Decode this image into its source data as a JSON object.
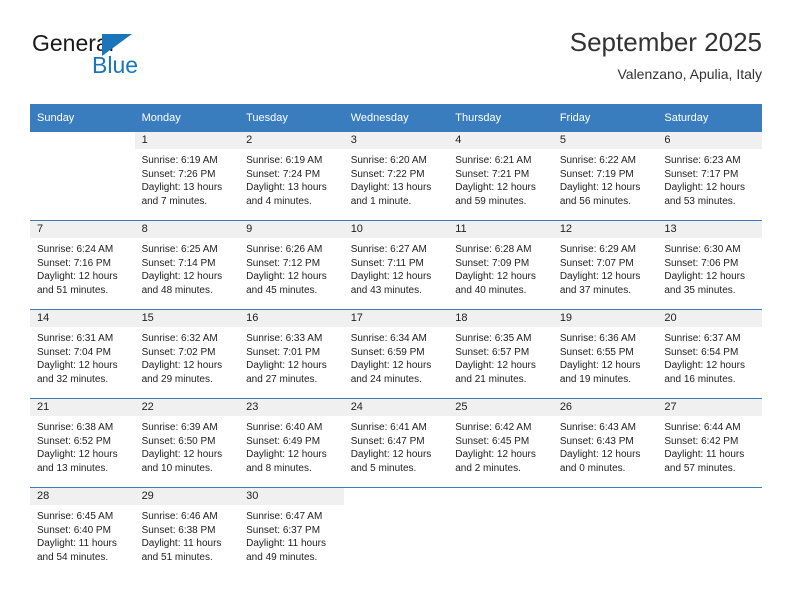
{
  "brand": {
    "line1": "General",
    "line2": "Blue",
    "triangle_color": "#1b75bb"
  },
  "header": {
    "title": "September 2025",
    "subtitle": "Valenzano, Apulia, Italy"
  },
  "theme": {
    "header_bg": "#3a7dbf",
    "header_text": "#ffffff",
    "daynum_bg": "#f0f0f0",
    "cell_bg": "#ffffff",
    "text": "#222222"
  },
  "weekdays": [
    "Sunday",
    "Monday",
    "Tuesday",
    "Wednesday",
    "Thursday",
    "Friday",
    "Saturday"
  ],
  "weeks": [
    [
      {
        "day": "",
        "blank": true
      },
      {
        "day": "1",
        "sunrise": "Sunrise: 6:19 AM",
        "sunset": "Sunset: 7:26 PM",
        "daylight": "Daylight: 13 hours and 7 minutes."
      },
      {
        "day": "2",
        "sunrise": "Sunrise: 6:19 AM",
        "sunset": "Sunset: 7:24 PM",
        "daylight": "Daylight: 13 hours and 4 minutes."
      },
      {
        "day": "3",
        "sunrise": "Sunrise: 6:20 AM",
        "sunset": "Sunset: 7:22 PM",
        "daylight": "Daylight: 13 hours and 1 minute."
      },
      {
        "day": "4",
        "sunrise": "Sunrise: 6:21 AM",
        "sunset": "Sunset: 7:21 PM",
        "daylight": "Daylight: 12 hours and 59 minutes."
      },
      {
        "day": "5",
        "sunrise": "Sunrise: 6:22 AM",
        "sunset": "Sunset: 7:19 PM",
        "daylight": "Daylight: 12 hours and 56 minutes."
      },
      {
        "day": "6",
        "sunrise": "Sunrise: 6:23 AM",
        "sunset": "Sunset: 7:17 PM",
        "daylight": "Daylight: 12 hours and 53 minutes."
      }
    ],
    [
      {
        "day": "7",
        "sunrise": "Sunrise: 6:24 AM",
        "sunset": "Sunset: 7:16 PM",
        "daylight": "Daylight: 12 hours and 51 minutes."
      },
      {
        "day": "8",
        "sunrise": "Sunrise: 6:25 AM",
        "sunset": "Sunset: 7:14 PM",
        "daylight": "Daylight: 12 hours and 48 minutes."
      },
      {
        "day": "9",
        "sunrise": "Sunrise: 6:26 AM",
        "sunset": "Sunset: 7:12 PM",
        "daylight": "Daylight: 12 hours and 45 minutes."
      },
      {
        "day": "10",
        "sunrise": "Sunrise: 6:27 AM",
        "sunset": "Sunset: 7:11 PM",
        "daylight": "Daylight: 12 hours and 43 minutes."
      },
      {
        "day": "11",
        "sunrise": "Sunrise: 6:28 AM",
        "sunset": "Sunset: 7:09 PM",
        "daylight": "Daylight: 12 hours and 40 minutes."
      },
      {
        "day": "12",
        "sunrise": "Sunrise: 6:29 AM",
        "sunset": "Sunset: 7:07 PM",
        "daylight": "Daylight: 12 hours and 37 minutes."
      },
      {
        "day": "13",
        "sunrise": "Sunrise: 6:30 AM",
        "sunset": "Sunset: 7:06 PM",
        "daylight": "Daylight: 12 hours and 35 minutes."
      }
    ],
    [
      {
        "day": "14",
        "sunrise": "Sunrise: 6:31 AM",
        "sunset": "Sunset: 7:04 PM",
        "daylight": "Daylight: 12 hours and 32 minutes."
      },
      {
        "day": "15",
        "sunrise": "Sunrise: 6:32 AM",
        "sunset": "Sunset: 7:02 PM",
        "daylight": "Daylight: 12 hours and 29 minutes."
      },
      {
        "day": "16",
        "sunrise": "Sunrise: 6:33 AM",
        "sunset": "Sunset: 7:01 PM",
        "daylight": "Daylight: 12 hours and 27 minutes."
      },
      {
        "day": "17",
        "sunrise": "Sunrise: 6:34 AM",
        "sunset": "Sunset: 6:59 PM",
        "daylight": "Daylight: 12 hours and 24 minutes."
      },
      {
        "day": "18",
        "sunrise": "Sunrise: 6:35 AM",
        "sunset": "Sunset: 6:57 PM",
        "daylight": "Daylight: 12 hours and 21 minutes."
      },
      {
        "day": "19",
        "sunrise": "Sunrise: 6:36 AM",
        "sunset": "Sunset: 6:55 PM",
        "daylight": "Daylight: 12 hours and 19 minutes."
      },
      {
        "day": "20",
        "sunrise": "Sunrise: 6:37 AM",
        "sunset": "Sunset: 6:54 PM",
        "daylight": "Daylight: 12 hours and 16 minutes."
      }
    ],
    [
      {
        "day": "21",
        "sunrise": "Sunrise: 6:38 AM",
        "sunset": "Sunset: 6:52 PM",
        "daylight": "Daylight: 12 hours and 13 minutes."
      },
      {
        "day": "22",
        "sunrise": "Sunrise: 6:39 AM",
        "sunset": "Sunset: 6:50 PM",
        "daylight": "Daylight: 12 hours and 10 minutes."
      },
      {
        "day": "23",
        "sunrise": "Sunrise: 6:40 AM",
        "sunset": "Sunset: 6:49 PM",
        "daylight": "Daylight: 12 hours and 8 minutes."
      },
      {
        "day": "24",
        "sunrise": "Sunrise: 6:41 AM",
        "sunset": "Sunset: 6:47 PM",
        "daylight": "Daylight: 12 hours and 5 minutes."
      },
      {
        "day": "25",
        "sunrise": "Sunrise: 6:42 AM",
        "sunset": "Sunset: 6:45 PM",
        "daylight": "Daylight: 12 hours and 2 minutes."
      },
      {
        "day": "26",
        "sunrise": "Sunrise: 6:43 AM",
        "sunset": "Sunset: 6:43 PM",
        "daylight": "Daylight: 12 hours and 0 minutes."
      },
      {
        "day": "27",
        "sunrise": "Sunrise: 6:44 AM",
        "sunset": "Sunset: 6:42 PM",
        "daylight": "Daylight: 11 hours and 57 minutes."
      }
    ],
    [
      {
        "day": "28",
        "sunrise": "Sunrise: 6:45 AM",
        "sunset": "Sunset: 6:40 PM",
        "daylight": "Daylight: 11 hours and 54 minutes."
      },
      {
        "day": "29",
        "sunrise": "Sunrise: 6:46 AM",
        "sunset": "Sunset: 6:38 PM",
        "daylight": "Daylight: 11 hours and 51 minutes."
      },
      {
        "day": "30",
        "sunrise": "Sunrise: 6:47 AM",
        "sunset": "Sunset: 6:37 PM",
        "daylight": "Daylight: 11 hours and 49 minutes."
      },
      {
        "day": "",
        "blank": true
      },
      {
        "day": "",
        "blank": true
      },
      {
        "day": "",
        "blank": true
      },
      {
        "day": "",
        "blank": true
      }
    ]
  ]
}
